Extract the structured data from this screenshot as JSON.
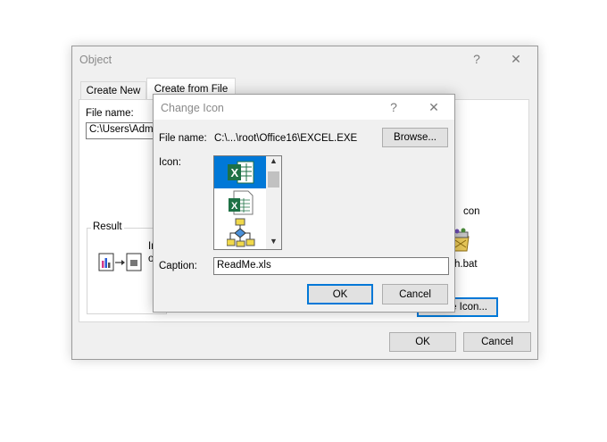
{
  "object_dialog": {
    "title": "Object",
    "help_glyph": "?",
    "close_glyph": "✕",
    "tabs": [
      {
        "label": "Create New"
      },
      {
        "label": "Create from File"
      }
    ],
    "file_name_label": "File name:",
    "file_name_value": "C:\\Users\\Admi",
    "result_label": "Result",
    "result_text_line1": "In",
    "result_text_line2": "o",
    "icon_label_partial": "con",
    "icon_caption_partial": "h.bat",
    "change_icon_partial": "e Icon...",
    "ok_label": "OK",
    "cancel_label": "Cancel"
  },
  "change_icon_dialog": {
    "title": "Change Icon",
    "help_glyph": "?",
    "close_glyph": "✕",
    "file_name_label": "File name:",
    "file_name_value": "C:\\...\\root\\Office16\\EXCEL.EXE",
    "browse_label": "Browse...",
    "icon_label": "Icon:",
    "icons": [
      "excel-xls-icon",
      "excel-sheet-icon",
      "flowchart-icon"
    ],
    "caption_label": "Caption:",
    "caption_value": "ReadMe.xls",
    "ok_label": "OK",
    "cancel_label": "Cancel"
  },
  "colors": {
    "accent": "#0078d7",
    "excel_green": "#1e7145",
    "selection": "#0078d7"
  }
}
